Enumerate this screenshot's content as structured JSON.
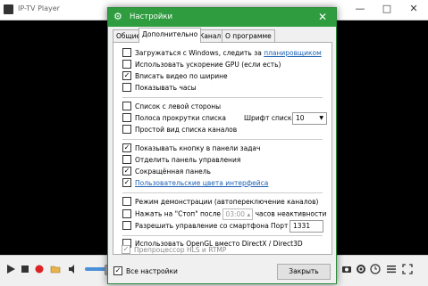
{
  "player": {
    "title": "IP-TV Player"
  },
  "dialog": {
    "title": "Настройки",
    "tabs": [
      "Общие",
      "Дополнительно",
      "Канал",
      "О программе"
    ],
    "active_tab": "Дополнительно",
    "options": [
      {
        "label_prefix": "Загружаться с Windows, следить за ",
        "link": "планировщиком",
        "checked": false
      },
      {
        "label": "Использовать ускорение GPU (если есть)",
        "checked": false
      },
      {
        "label": "Вписать видео по ширине",
        "checked": true
      },
      {
        "label": "Показывать часы",
        "checked": false
      },
      {
        "label": "Список с левой стороны",
        "checked": false
      },
      {
        "label": "Полоса прокрутки списка",
        "checked": false
      },
      {
        "label": "Простой вид списка каналов",
        "checked": false
      },
      {
        "label": "Показывать кнопку в панели задач",
        "checked": true
      },
      {
        "label": "Отделить панель управления",
        "checked": false
      },
      {
        "label": "Сокращённая панель",
        "checked": true
      },
      {
        "label": "Пользовательские цвета интерфейса",
        "checked": true,
        "link": true
      },
      {
        "label": "Режим демонстрации (автопереключение каналов)",
        "checked": false
      },
      {
        "label_prefix": "Нажать на \"Стоп\" после",
        "time_value": "03:00",
        "label_suffix": "часов неактивности",
        "checked": false
      },
      {
        "label": "Разрешить управление со смартфона",
        "checked": false
      },
      {
        "label": "Использовать OpenGL вместо DirectX / Direct3D",
        "checked": false
      },
      {
        "label": "Препроцессор HLS и RTMP",
        "checked": true,
        "disabled": true
      }
    ],
    "font_label": "Шрифт списка",
    "font_value": "10",
    "port_label": "Порт",
    "port_value": "1331",
    "all_settings_label": "Все настройки",
    "all_settings_checked": true,
    "close_button": "Закрыть"
  }
}
